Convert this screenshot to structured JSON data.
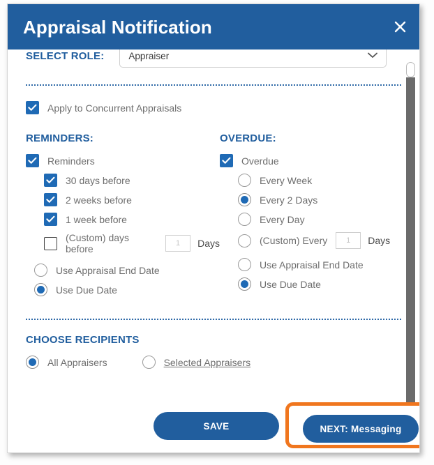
{
  "dialog": {
    "title": "Appraisal Notification",
    "close_icon": "close-icon",
    "header_color": "#215E9E"
  },
  "select_role": {
    "label": "SELECT ROLE:",
    "value": "Appraiser",
    "caret_icon": "chevron-down-icon"
  },
  "concurrent": {
    "label": "Apply to Concurrent Appraisals",
    "checked": true
  },
  "reminders": {
    "heading": "REMINDERS:",
    "master": {
      "label": "Reminders",
      "checked": true
    },
    "checkboxes": [
      {
        "label": "30 days before",
        "checked": true
      },
      {
        "label": "2 weeks before",
        "checked": true
      },
      {
        "label": "1 week before",
        "checked": true
      },
      {
        "label": "(Custom) days before",
        "checked": false
      }
    ],
    "custom_days_value": "1",
    "custom_days_placeholder": "1",
    "days_suffix": "Days",
    "date_basis": [
      {
        "label": "Use Appraisal End Date",
        "selected": false
      },
      {
        "label": "Use Due Date",
        "selected": true
      }
    ]
  },
  "overdue": {
    "heading": "OVERDUE:",
    "master": {
      "label": "Overdue",
      "checked": true
    },
    "frequency": [
      {
        "label": "Every Week",
        "selected": false
      },
      {
        "label": "Every 2 Days",
        "selected": true
      },
      {
        "label": "Every Day",
        "selected": false
      },
      {
        "label": "(Custom) Every",
        "selected": false
      }
    ],
    "custom_days_value": "1",
    "custom_days_placeholder": "1",
    "days_suffix": "Days",
    "date_basis": [
      {
        "label": "Use Appraisal End Date",
        "selected": false
      },
      {
        "label": "Use Due Date",
        "selected": true
      }
    ]
  },
  "recipients": {
    "heading": "CHOOSE RECIPIENTS",
    "options": [
      {
        "label": "All Appraisers",
        "selected": true
      },
      {
        "label": "Selected Appraisers",
        "selected": false
      }
    ]
  },
  "footer": {
    "save_label": "SAVE",
    "next_label": "NEXT: Messaging",
    "highlight_color": "#F0761E"
  }
}
